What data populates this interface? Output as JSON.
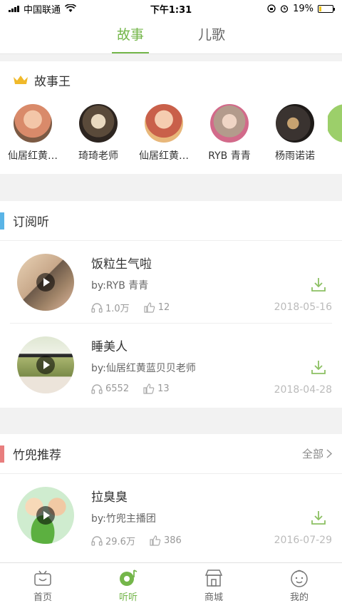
{
  "status_bar": {
    "carrier": "中国联通",
    "time": "下午1:31",
    "battery_text": "19%",
    "battery_level": 0.19
  },
  "tabs": [
    {
      "label": "故事",
      "active": true
    },
    {
      "label": "儿歌",
      "active": false
    }
  ],
  "story_king": {
    "title": "故事王",
    "crown_icon": "crown-icon",
    "people": [
      {
        "name": "仙居红黄…",
        "avatar_color": "#d98a6a"
      },
      {
        "name": "琦琦老师",
        "avatar_color": "#5a4a3a"
      },
      {
        "name": "仙居红黄…",
        "avatar_color": "#c9604a"
      },
      {
        "name": "RYB 青青",
        "avatar_color": "#b39b8c"
      },
      {
        "name": "杨雨诺诺",
        "avatar_color": "#3a3330"
      }
    ]
  },
  "subscription": {
    "title": "订阅听",
    "accent": "#5ab4e6",
    "items": [
      {
        "title": "饭粒生气啦",
        "author": "by:RYB 青青",
        "plays": "1.0万",
        "likes": "12",
        "date": "2018-05-16",
        "thumb_color": "#c8a88a"
      },
      {
        "title": "睡美人",
        "author": "by:仙居红黄蓝贝贝老师",
        "plays": "6552",
        "likes": "13",
        "date": "2018-04-28",
        "thumb_color": "#9aa56e"
      }
    ]
  },
  "recommend": {
    "title": "竹兜推荐",
    "more": "全部",
    "accent": "#e87e7e",
    "items": [
      {
        "title": "拉臭臭",
        "author": "by:竹兜主播团",
        "plays": "29.6万",
        "likes": "386",
        "date": "2016-07-29",
        "thumb_color": "#b8dfa8"
      }
    ]
  },
  "bottom_nav": [
    {
      "label": "首页",
      "icon": "tv-home-icon",
      "active": false
    },
    {
      "label": "听听",
      "icon": "music-listen-icon",
      "active": true
    },
    {
      "label": "商城",
      "icon": "shop-icon",
      "active": false
    },
    {
      "label": "我的",
      "icon": "face-profile-icon",
      "active": false
    }
  ],
  "colors": {
    "brand_green": "#74b64a",
    "download_green": "#8cc063"
  }
}
